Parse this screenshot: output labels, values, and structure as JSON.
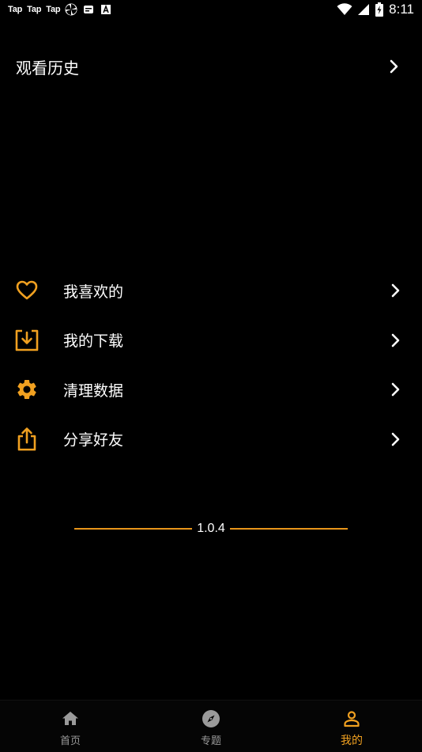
{
  "status_bar": {
    "left_texts": [
      "Tap",
      "Tap",
      "Tap"
    ],
    "time": "8:11",
    "icons": [
      "pinwheel-icon",
      "message-icon",
      "font-a-icon",
      "wifi-icon",
      "signal-icon",
      "battery-charging-icon"
    ]
  },
  "history": {
    "label": "观看历史"
  },
  "menu": {
    "items": [
      {
        "label": "我喜欢的",
        "icon": "heart-icon"
      },
      {
        "label": "我的下载",
        "icon": "download-icon"
      },
      {
        "label": "清理数据",
        "icon": "gear-icon"
      },
      {
        "label": "分享好友",
        "icon": "share-icon"
      }
    ]
  },
  "version": "1.0.4",
  "bottom_nav": {
    "items": [
      {
        "label": "首页",
        "icon": "home-icon",
        "active": false
      },
      {
        "label": "专题",
        "icon": "compass-icon",
        "active": false
      },
      {
        "label": "我的",
        "icon": "person-icon",
        "active": true
      }
    ]
  },
  "colors": {
    "accent": "#f0a020",
    "background": "#000000",
    "inactive": "#9a9a9a"
  }
}
